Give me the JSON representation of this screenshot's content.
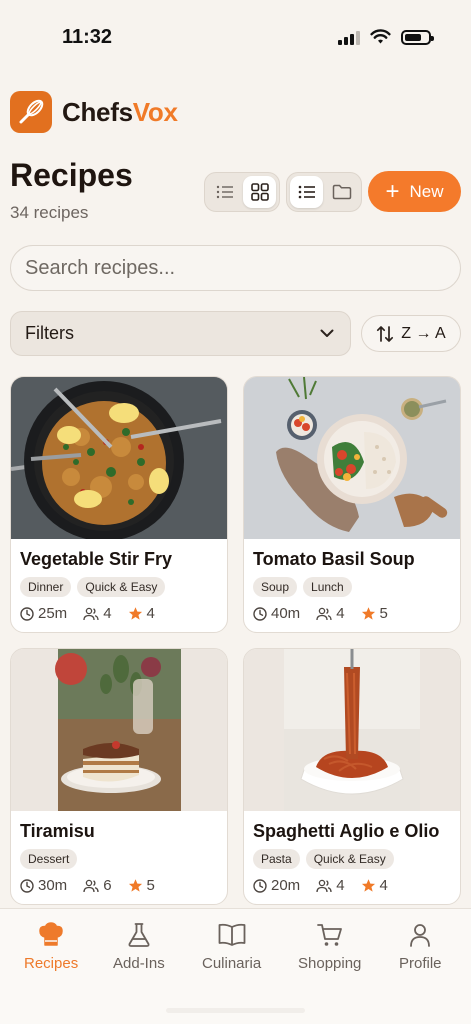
{
  "status_bar": {
    "time": "11:32",
    "icons": [
      "signal-icon",
      "wifi-icon",
      "battery-icon"
    ]
  },
  "brand": {
    "name_part1": "Chefs",
    "name_part2": "Vox",
    "logo_icon": "whisk-icon",
    "accent": "#f07a28"
  },
  "header": {
    "title": "Recipes",
    "count_text": "34 recipes"
  },
  "view_toggle": {
    "list_icon": "list-icon",
    "grid_icon": "grid-icon",
    "active": "grid"
  },
  "mode_toggle": {
    "list_icon": "list-icon",
    "folder_icon": "folder-icon",
    "active": "list"
  },
  "new_button": {
    "label": "New",
    "icon": "plus-icon"
  },
  "search": {
    "placeholder": "Search recipes...",
    "value": ""
  },
  "filters": {
    "label": "Filters",
    "icon": "chevron-down-icon"
  },
  "sort": {
    "label": "Z → A",
    "icon": "sort-arrows-icon"
  },
  "recipes": [
    {
      "title": "Vegetable Stir Fry",
      "tags": [
        "Dinner",
        "Quick & Easy"
      ],
      "time": "25m",
      "servings": "4",
      "rating": "4",
      "image": "paella-pan"
    },
    {
      "title": "Tomato Basil Soup",
      "tags": [
        "Soup",
        "Lunch"
      ],
      "time": "40m",
      "servings": "4",
      "rating": "5",
      "image": "salad-bowl"
    },
    {
      "title": "Tiramisu",
      "tags": [
        "Dessert"
      ],
      "time": "30m",
      "servings": "6",
      "rating": "5",
      "image": "tiramisu-slice"
    },
    {
      "title": "Spaghetti Aglio e Olio",
      "tags": [
        "Pasta",
        "Quick & Easy"
      ],
      "time": "20m",
      "servings": "4",
      "rating": "4",
      "image": "spaghetti-fork"
    }
  ],
  "bottom_nav": [
    {
      "label": "Recipes",
      "icon": "chef-hat-icon",
      "active": true
    },
    {
      "label": "Add-Ins",
      "icon": "flask-icon",
      "active": false
    },
    {
      "label": "Culinaria",
      "icon": "book-icon",
      "active": false
    },
    {
      "label": "Shopping",
      "icon": "cart-icon",
      "active": false
    },
    {
      "label": "Profile",
      "icon": "user-icon",
      "active": false
    }
  ]
}
